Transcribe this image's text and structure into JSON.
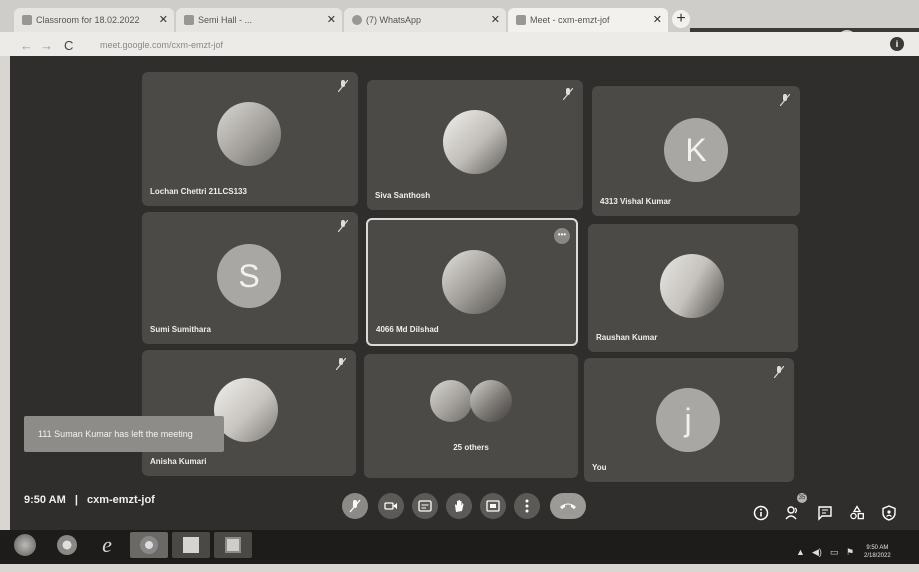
{
  "browser": {
    "tabs": [
      {
        "label": "Classroom for 18.02.2022"
      },
      {
        "label": "Semi Hall - ..."
      },
      {
        "label": "(7) WhatsApp"
      },
      {
        "label": "Meet - cxm-emzt-jof"
      }
    ],
    "new_tab_label": "+",
    "url": "meet.google.com/cxm-emzt-jof",
    "nav": {
      "back": "←",
      "forward": "→",
      "reload": "C"
    }
  },
  "meeting": {
    "participants": [
      {
        "name": "Lochan Chettri 21LCS133",
        "avatar_type": "photo"
      },
      {
        "name": "Siva Santhosh",
        "avatar_type": "photo"
      },
      {
        "name": "4313 Vishal Kumar",
        "avatar_type": "letter",
        "letter": "K"
      },
      {
        "name": "Sumi Sumithara",
        "avatar_type": "letter",
        "letter": "S"
      },
      {
        "name": "4066 Md Dilshad",
        "avatar_type": "photo",
        "selected": true
      },
      {
        "name": "Raushan Kumar",
        "avatar_type": "photo"
      },
      {
        "name": "Anisha Kumari",
        "avatar_type": "photo"
      },
      {
        "name": "25 others",
        "avatar_type": "group"
      },
      {
        "name": "You",
        "avatar_type": "letter",
        "letter": "j"
      }
    ],
    "toast": "111 Suman Kumar has left the meeting",
    "time": "9:50 AM",
    "separator": "|",
    "meeting_code": "cxm-emzt-jof",
    "people_count_badge": "35",
    "more_options": "•••"
  },
  "taskbar": {
    "clock_time": "9:50 AM",
    "clock_date": "2/18/2022"
  },
  "colors": {
    "meet_bg": "#2f2e2c",
    "tile_bg": "#4b4a47",
    "end_call": "#9c9a96"
  }
}
